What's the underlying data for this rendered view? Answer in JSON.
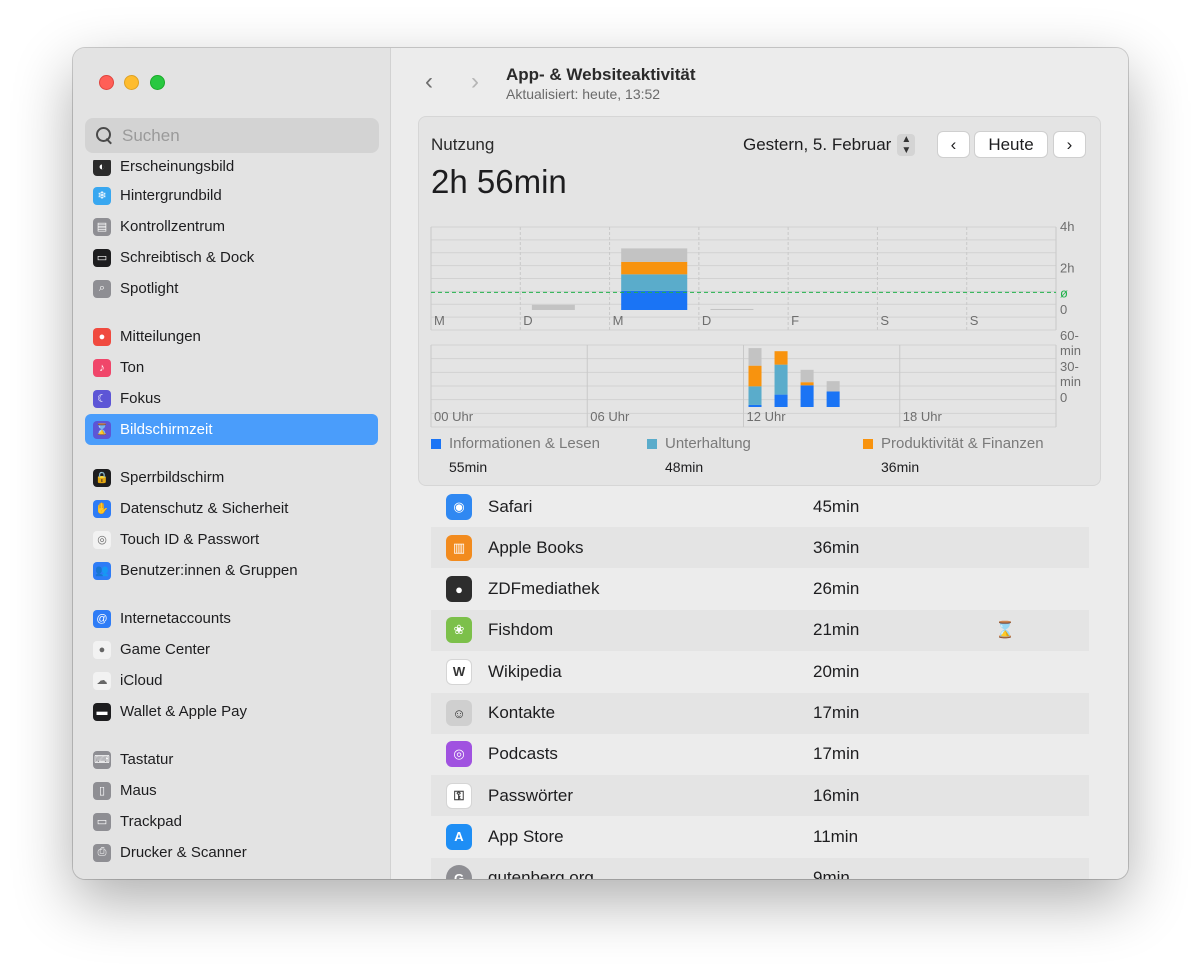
{
  "window": {
    "title": "App- & Websiteaktivität",
    "subtitle": "Aktualisiert: heute, 13:52"
  },
  "sidebar": {
    "search_placeholder": "Suchen",
    "items": [
      {
        "label": "Erscheinungsbild",
        "icon": "appearance-icon",
        "color": "#2b2b2b"
      },
      {
        "label": "Hintergrundbild",
        "icon": "wallpaper-icon",
        "color": "#38a7f0"
      },
      {
        "label": "Kontrollzentrum",
        "icon": "control-center-icon",
        "color": "#8e8e93"
      },
      {
        "label": "Schreibtisch & Dock",
        "icon": "dock-icon",
        "color": "#1d1d1f"
      },
      {
        "label": "Spotlight",
        "icon": "spotlight-icon",
        "color": "#8e8e93"
      },
      {
        "label": "Mitteilungen",
        "icon": "notifications-icon",
        "color": "#f04a3f"
      },
      {
        "label": "Ton",
        "icon": "sound-icon",
        "color": "#f0466a"
      },
      {
        "label": "Fokus",
        "icon": "focus-icon",
        "color": "#5d55d6"
      },
      {
        "label": "Bildschirmzeit",
        "icon": "screen-time-icon",
        "color": "#5d55d6",
        "selected": true
      },
      {
        "label": "Sperrbildschirm",
        "icon": "lock-screen-icon",
        "color": "#1d1d1f"
      },
      {
        "label": "Datenschutz & Sicherheit",
        "icon": "privacy-hand-icon",
        "color": "#2e7cf6"
      },
      {
        "label": "Touch ID & Passwort",
        "icon": "fingerprint-icon",
        "color": "#f2f2f2"
      },
      {
        "label": "Benutzer:innen & Gruppen",
        "icon": "users-icon",
        "color": "#2e7cf6"
      },
      {
        "label": "Internetaccounts",
        "icon": "at-icon",
        "color": "#2e7cf6"
      },
      {
        "label": "Game Center",
        "icon": "game-center-icon",
        "color": "#f2f2f2"
      },
      {
        "label": "iCloud",
        "icon": "icloud-icon",
        "color": "#f2f2f2"
      },
      {
        "label": "Wallet & Apple Pay",
        "icon": "wallet-icon",
        "color": "#1d1d1f"
      },
      {
        "label": "Tastatur",
        "icon": "keyboard-icon",
        "color": "#8e8e93"
      },
      {
        "label": "Maus",
        "icon": "mouse-icon",
        "color": "#8e8e93"
      },
      {
        "label": "Trackpad",
        "icon": "trackpad-icon",
        "color": "#8e8e93"
      },
      {
        "label": "Drucker & Scanner",
        "icon": "printer-icon",
        "color": "#8e8e93"
      }
    ]
  },
  "usage": {
    "label": "Nutzung",
    "total": "2h 56min",
    "date": "Gestern, 5. Februar",
    "today_label": "Heute"
  },
  "colors": {
    "info": "#1a74f5",
    "entertainment": "#5aaccb",
    "productivity": "#f8930e",
    "other": "#c3c3c3",
    "average": "#22b14c"
  },
  "chart_data": [
    {
      "type": "bar",
      "title": "",
      "categories": [
        "M",
        "D",
        "M",
        "D",
        "F",
        "S",
        "S"
      ],
      "y_ticks": [
        "4h",
        "2h",
        "0"
      ],
      "ylim": [
        0,
        4
      ],
      "average_symbol": "ø",
      "average_hours": 0.85,
      "series": [
        {
          "name": "Informationen & Lesen",
          "values": [
            0,
            0,
            0.92,
            0,
            0,
            0,
            0
          ]
        },
        {
          "name": "Unterhaltung",
          "values": [
            0,
            0,
            0.8,
            0,
            0,
            0,
            0
          ]
        },
        {
          "name": "Produktivität & Finanzen",
          "values": [
            0,
            0,
            0.6,
            0,
            0,
            0,
            0
          ]
        },
        {
          "values": [
            0,
            0.25,
            0.65,
            0.05,
            0,
            0,
            0
          ]
        }
      ]
    },
    {
      "type": "bar",
      "title": "",
      "categories": [
        "12",
        "13",
        "14",
        "15"
      ],
      "x_ticks": [
        "00 Uhr",
        "06 Uhr",
        "12 Uhr",
        "18 Uhr"
      ],
      "y_ticks": [
        "60-\nmin",
        "30-\nmin",
        "0"
      ],
      "y_tick_lines": [
        [
          "60-",
          "min"
        ],
        [
          "30-",
          "min"
        ],
        [
          "0"
        ]
      ],
      "ylim": [
        0,
        60
      ],
      "series": [
        {
          "name": "Informationen & Lesen",
          "values": [
            2,
            12,
            21,
            15
          ]
        },
        {
          "name": "Unterhaltung",
          "values": [
            18,
            29,
            0,
            0
          ]
        },
        {
          "name": "Produktivität & Finanzen",
          "values": [
            20,
            13,
            3,
            0
          ]
        },
        {
          "values": [
            17,
            0,
            12,
            10
          ]
        }
      ]
    }
  ],
  "legend": [
    {
      "label": "Informationen & Lesen",
      "value": "55min",
      "color": "#1a74f5"
    },
    {
      "label": "Unterhaltung",
      "value": "48min",
      "color": "#5aaccb"
    },
    {
      "label": "Produktivität & Finanzen",
      "value": "36min",
      "color": "#f8930e"
    }
  ],
  "apps": [
    {
      "name": "Safari",
      "time": "45min",
      "icon": "safari-icon",
      "color": "#2f88f2"
    },
    {
      "name": "Apple Books",
      "time": "36min",
      "icon": "books-icon",
      "color": "#f28b1e"
    },
    {
      "name": "ZDFmediathek",
      "time": "26min",
      "icon": "zdf-icon",
      "color": "#2d2d2d"
    },
    {
      "name": "Fishdom",
      "time": "21min",
      "icon": "fishdom-icon",
      "color": "#7cc04a",
      "limit_icon": "⌛"
    },
    {
      "name": "Wikipedia",
      "time": "20min",
      "icon": "wikipedia-icon",
      "color": "#ffffff"
    },
    {
      "name": "Kontakte",
      "time": "17min",
      "icon": "contacts-icon",
      "color": "#cfcfcf"
    },
    {
      "name": "Podcasts",
      "time": "17min",
      "icon": "podcasts-icon",
      "color": "#a052e0"
    },
    {
      "name": "Passwörter",
      "time": "16min",
      "icon": "passwords-icon",
      "color": "#ffffff"
    },
    {
      "name": "App Store",
      "time": "11min",
      "icon": "app-store-icon",
      "color": "#1e8ef5"
    },
    {
      "name": "gutenberg.org",
      "time": "9min",
      "icon": "website-icon",
      "color": "#8e8e93"
    }
  ]
}
